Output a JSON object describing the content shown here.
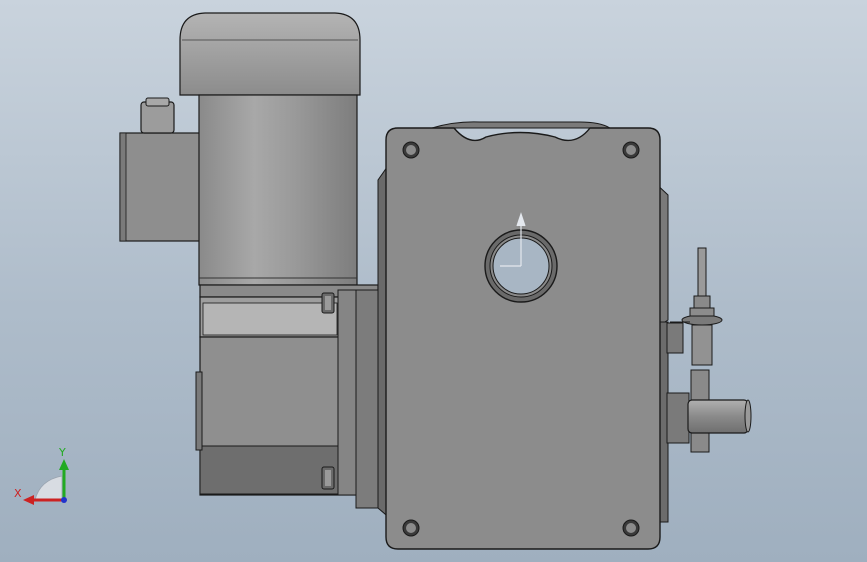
{
  "viewport": {
    "background_top": "#c9d3dd",
    "background_bottom": "#9fafbf"
  },
  "model": {
    "part_colors": {
      "housing": "#8c8c8c",
      "housing_dark": "#6e6e6e",
      "motor": "#9a9a9a",
      "motor_shadow": "#7a7a7a",
      "edge": "#1a1a1a",
      "bore": "#a8b6c4"
    }
  },
  "triad": {
    "x_label": "X",
    "y_label": "Y",
    "x_color": "#cc2222",
    "y_color": "#22aa22",
    "z_color": "#2233cc"
  }
}
